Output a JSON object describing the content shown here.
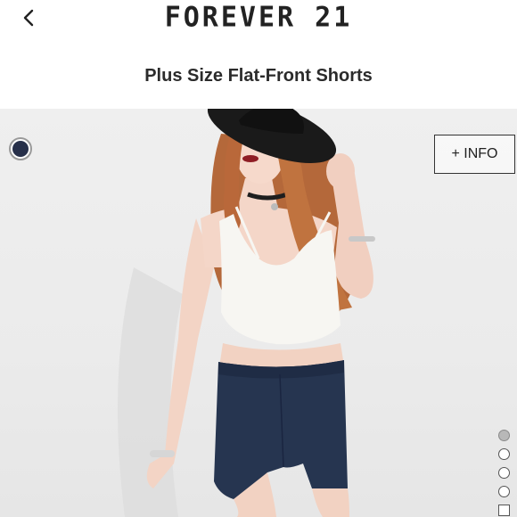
{
  "header": {
    "brand": "FOREVER 21",
    "back_icon": "chevron-left-icon"
  },
  "product": {
    "title": "Plus Size Flat-Front Shorts"
  },
  "gallery": {
    "info_button_label": "+ INFO",
    "swatch_color": "#27304a",
    "image_count": 5,
    "active_index": 0
  }
}
